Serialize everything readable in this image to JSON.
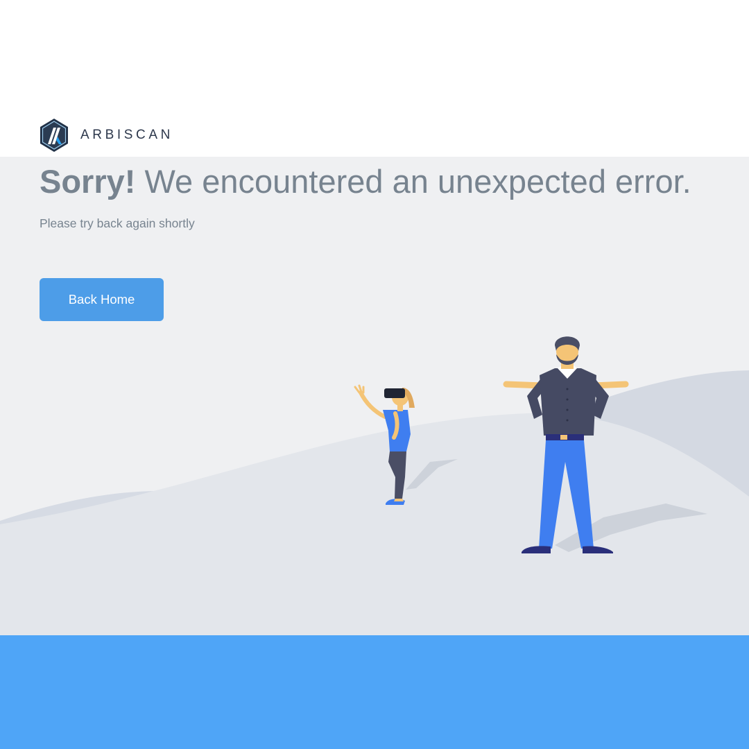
{
  "brand": {
    "name": "ARBISCAN",
    "logo_icon": "arbitrum-logo-icon"
  },
  "error": {
    "headline_strong": "Sorry!",
    "headline_rest": " We encountered an unexpected error.",
    "subtext": "Please try back again shortly"
  },
  "actions": {
    "back_home_label": "Back Home"
  },
  "colors": {
    "header_bg": "#ffffff",
    "content_bg": "#eff0f2",
    "text_muted": "#77838f",
    "button_bg": "#4d9de8",
    "footer_bg": "#4fa5f7",
    "logo_navy": "#2c374b",
    "shirt_blue": "#3f7ef0",
    "skin": "#f4c476"
  }
}
